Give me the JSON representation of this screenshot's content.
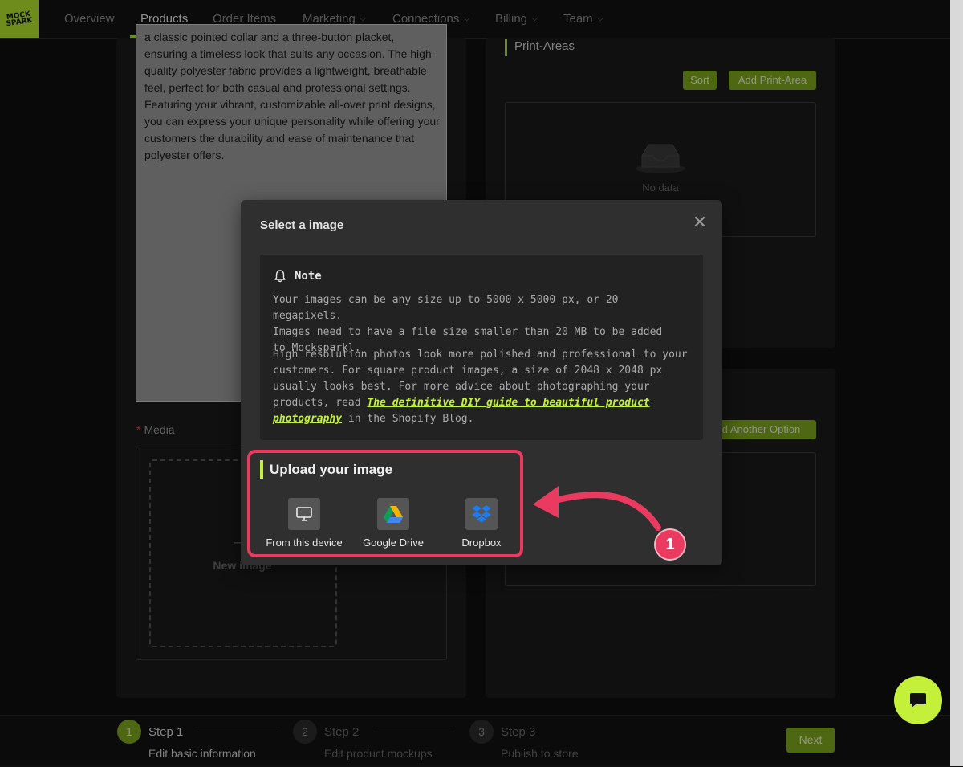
{
  "app": {
    "logo_text": "MOCK SPARK",
    "brand_color": "#b2e22d"
  },
  "nav": {
    "items": [
      {
        "label": "Overview",
        "has_dropdown": false
      },
      {
        "label": "Products",
        "has_dropdown": false,
        "active": true
      },
      {
        "label": "Order Items",
        "has_dropdown": false
      },
      {
        "label": "Marketing",
        "has_dropdown": true
      },
      {
        "label": "Connections",
        "has_dropdown": true
      },
      {
        "label": "Billing",
        "has_dropdown": true
      },
      {
        "label": "Team",
        "has_dropdown": true
      }
    ]
  },
  "product_form": {
    "description": "a classic pointed collar and a three-button placket, ensuring a timeless look that suits any occasion. The high-quality polyester fabric provides a lightweight, breathable feel, perfect for both casual and professional settings. Featuring your vibrant, customizable all-over print designs, you can express your unique personality while offering your customers the durability and ease of maintenance that polyester offers.",
    "media_label": "Media",
    "required_mark": "*",
    "new_image_label": "New image"
  },
  "print_areas": {
    "title": "Print-Areas",
    "sort_label": "Sort",
    "add_label": "Add Print-Area",
    "empty_text": "No data"
  },
  "options": {
    "add_option_label": "d Another Option"
  },
  "modal": {
    "title": "Select a image",
    "close_icon": "close-icon",
    "note": {
      "title": "Note",
      "para1_lines": [
        "Your images can be any size up to 5000 x 5000 px, or 20 megapixels.",
        "Images need to have a file size smaller than 20 MB to be added",
        "to Mocksparkl."
      ],
      "para2_lines": [
        "High resolution photos look more polished and professional to your",
        "customers. For square product images, a size of 2048 x 2048 px",
        "usually looks best. For more advice about photographing your"
      ],
      "para2_line4_prefix": "products, read ",
      "link_part1": "The definitive DIY guide to beautiful product",
      "link_part2": "photography",
      "para2_suffix": " in the Shopify Blog."
    },
    "upload": {
      "title": "Upload your image",
      "sources": [
        {
          "label": "From this device",
          "icon": "monitor-icon"
        },
        {
          "label": "Google Drive",
          "icon": "google-drive-icon"
        },
        {
          "label": "Dropbox",
          "icon": "dropbox-icon"
        }
      ]
    }
  },
  "annotation": {
    "badge_number": "1",
    "color": "#ea3a5f"
  },
  "steps": [
    {
      "number": "1",
      "title": "Step 1",
      "subtitle": "Edit basic information",
      "active": true
    },
    {
      "number": "2",
      "title": "Step 2",
      "subtitle": "Edit product mockups",
      "active": false
    },
    {
      "number": "3",
      "title": "Step 3",
      "subtitle": "Publish to store",
      "active": false
    }
  ],
  "next_label": "Next"
}
